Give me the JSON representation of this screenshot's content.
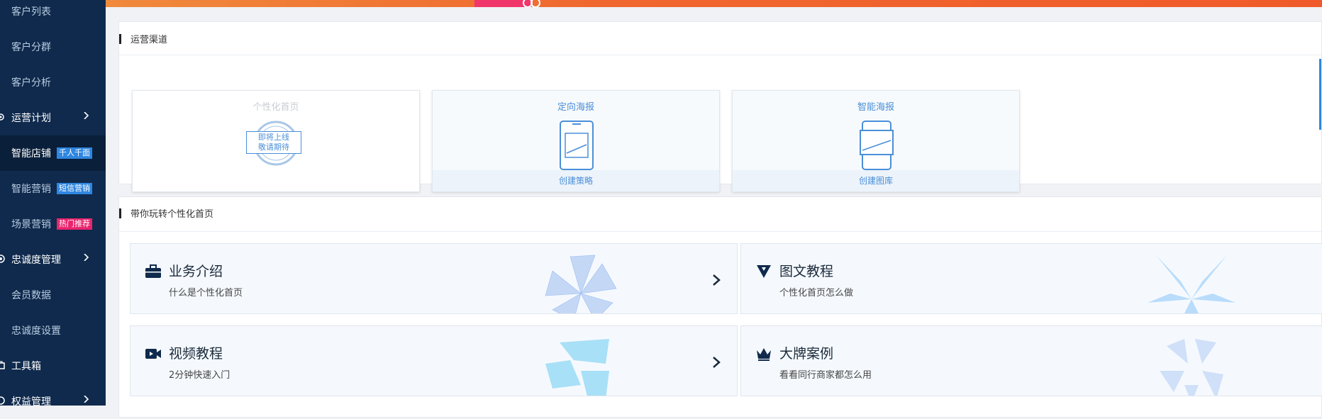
{
  "sidebar": {
    "items": [
      {
        "label": "客户列表"
      },
      {
        "label": "客户分群"
      },
      {
        "label": "客户分析"
      },
      {
        "label": "运营计划"
      },
      {
        "label": "智能店铺",
        "badge": "千人千面"
      },
      {
        "label": "智能营销",
        "badge": "短信营销"
      },
      {
        "label": "场景营销",
        "badge": "热门推荐"
      },
      {
        "label": "忠诚度管理"
      },
      {
        "label": "会员数据"
      },
      {
        "label": "忠诚度设置"
      },
      {
        "label": "工具箱"
      },
      {
        "label": "权益管理"
      }
    ],
    "colors": {
      "bg": "#0f2a4d",
      "active_bg": "#0a1f3a",
      "badge_blue": "#2f86e0",
      "badge_pink": "#e8246d"
    }
  },
  "channels": {
    "title": "运营渠道",
    "cards": [
      {
        "title": "个性化首页",
        "stamp_line1": "即将上线",
        "stamp_line2": "敬请期待"
      },
      {
        "title": "定向海报",
        "footer": "创建策略"
      },
      {
        "title": "智能海报",
        "footer": "创建图库"
      }
    ]
  },
  "guide": {
    "title": "带你玩转个性化首页",
    "cards": [
      {
        "title": "业务介绍",
        "subtitle": "什么是个性化首页",
        "icon": "briefcase-icon"
      },
      {
        "title": "图文教程",
        "subtitle": "个性化首页怎么做",
        "icon": "triangle-logo-icon"
      },
      {
        "title": "视频教程",
        "subtitle": "2分钟快速入门",
        "icon": "video-camera-icon"
      },
      {
        "title": "大牌案例",
        "subtitle": "看看同行商家都怎么用",
        "icon": "crown-icon"
      }
    ]
  },
  "colors": {
    "accent": "#4a8fd8",
    "banner": "#f0682f"
  }
}
